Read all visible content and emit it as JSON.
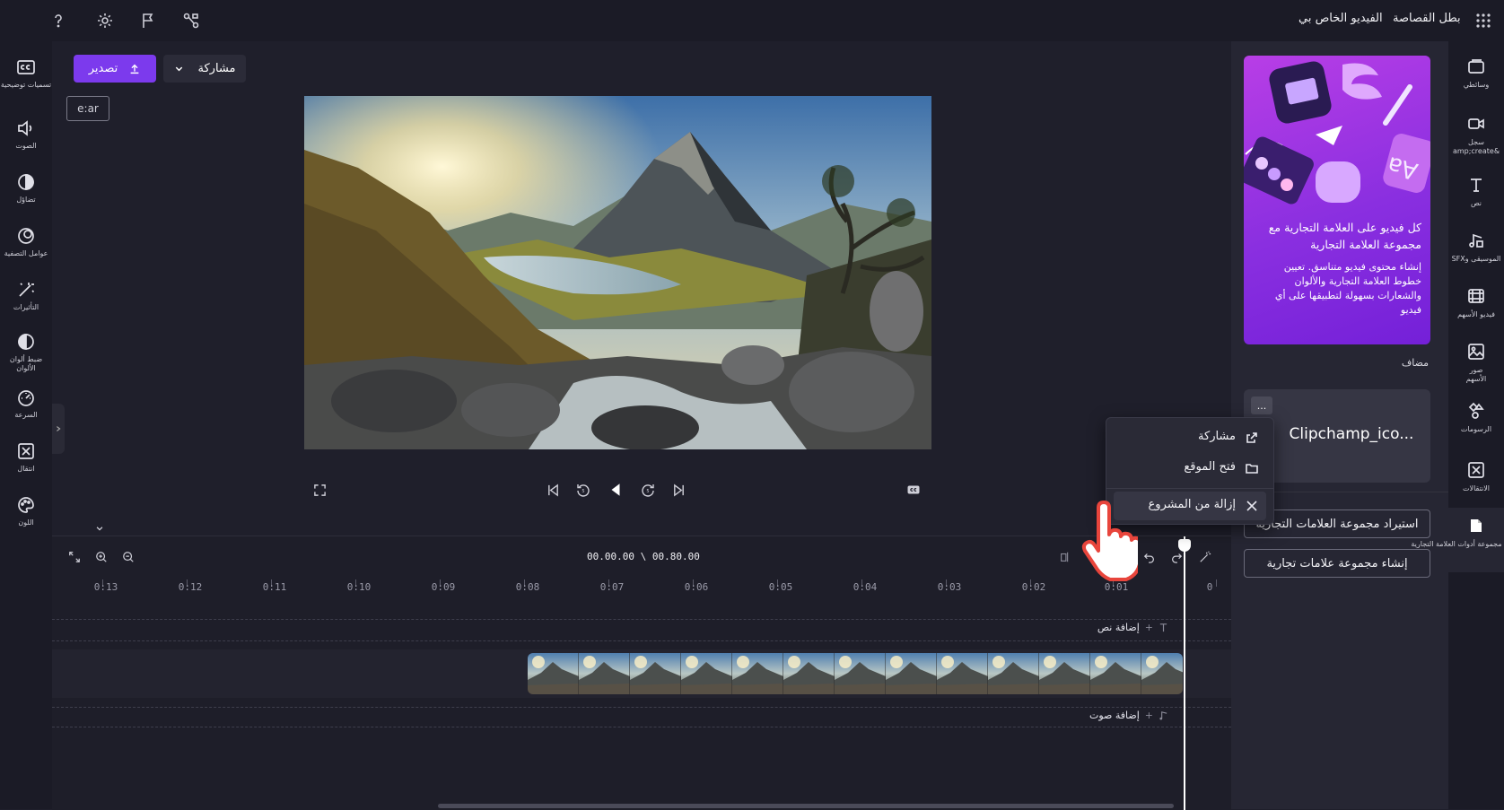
{
  "topbar": {
    "project_title": "الفيديو الخاص بي",
    "hero_label": "بطل القصاصة"
  },
  "toolbar": {
    "export_label": "تصدير",
    "share_label": "مشاركة",
    "language_badge": "e:ar"
  },
  "left_rail": [
    {
      "label": "تسميات توضيحية",
      "icon": "captions-icon"
    },
    {
      "label": "الصوت",
      "icon": "audio-icon"
    },
    {
      "label": "تضاؤل",
      "icon": "fade-icon"
    },
    {
      "label": "عوامل التصفية",
      "icon": "filters-icon"
    },
    {
      "label": "التأثيرات",
      "icon": "effects-icon"
    },
    {
      "label": "ضبط ألوان الألوان",
      "icon": "adjust-colors-icon"
    },
    {
      "label": "السرعة",
      "icon": "speed-icon"
    },
    {
      "label": "انتقال",
      "icon": "transition-icon"
    },
    {
      "label": "اللون",
      "icon": "color-icon"
    }
  ],
  "right_rail": [
    {
      "label": "وسائطي",
      "icon": "media-icon"
    },
    {
      "label": "سجل &amp;create",
      "icon": "record-create-icon"
    },
    {
      "label": "نص",
      "icon": "text-icon"
    },
    {
      "label": "الموسيقى وSFX",
      "icon": "music-sfx-icon"
    },
    {
      "label": "فيديو الأسهم",
      "icon": "stock-video-icon"
    },
    {
      "label": "صور الأسهم",
      "icon": "stock-images-icon"
    },
    {
      "label": "الرسومات",
      "icon": "graphics-icon"
    },
    {
      "label": "الانتقالات",
      "icon": "transitions-icon"
    },
    {
      "label": "مجموعة أدوات العلامة التجارية",
      "icon": "brand-kit-icon"
    }
  ],
  "brand_panel": {
    "promo_title": "كل فيديو على العلامة التجارية مع مجموعة العلامة التجارية",
    "promo_body": "إنشاء محتوى فيديو متناسق. تعيين خطوط العلامة التجارية والألوان والشعارات بسهولة لتطبيقها على أي فيديو",
    "added_label": "مضاف",
    "file_name": "Clipchamp_ico...",
    "more_label": "...",
    "import_button": "استيراد مجموعة العلامات التجارية",
    "create_button": "إنشاء مجموعة علامات تجارية"
  },
  "context_menu": {
    "share": "مشاركة",
    "open_location": "فتح الموقع",
    "remove": "إزالة من المشروع"
  },
  "timeline": {
    "timecode": "00.00.00 \\ 00.80.00",
    "ruler_labels": [
      "0",
      "0:01",
      "0:02",
      "0:03",
      "0:04",
      "0:05",
      "0:06",
      "0:07",
      "0:08",
      "0:09",
      "0:10",
      "0:11",
      "0:12",
      "0:13"
    ],
    "add_text": "إضافة نص",
    "add_audio": "إضافة صوت"
  },
  "colors": {
    "accent": "#7c3aed",
    "background": "#1f1f2b",
    "panel": "#262633"
  }
}
